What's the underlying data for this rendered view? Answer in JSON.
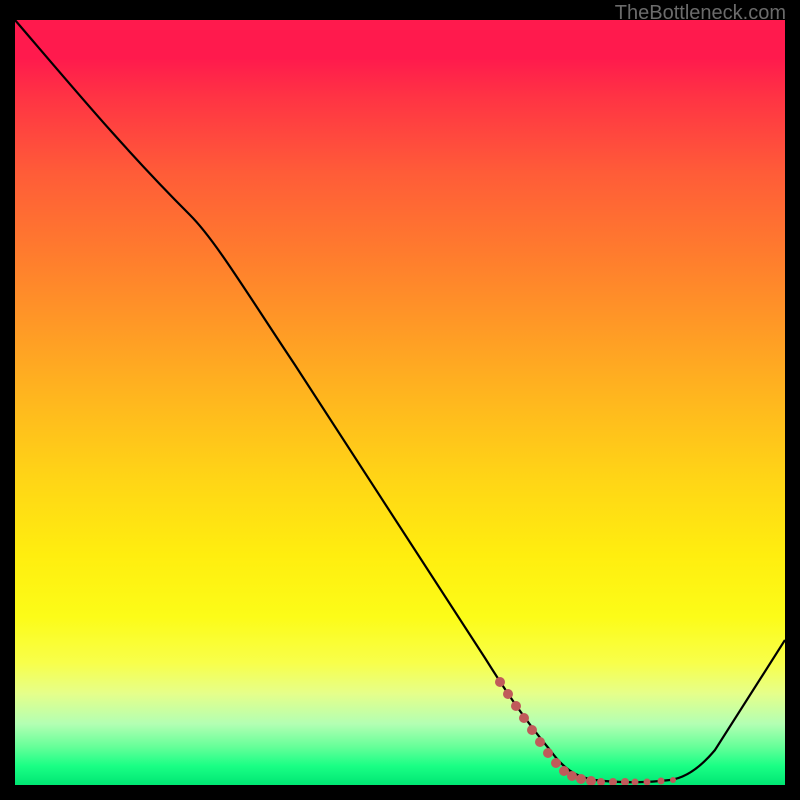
{
  "watermark": "TheBottleneck.com",
  "chart_data": {
    "type": "line",
    "title": "",
    "xlabel": "",
    "ylabel": "",
    "ylim": [
      0,
      100
    ],
    "xlim": [
      0,
      100
    ],
    "series": [
      {
        "name": "curve",
        "x": [
          0,
          10,
          20,
          30,
          40,
          50,
          60,
          65,
          70,
          75,
          80,
          85,
          90,
          100
        ],
        "y": [
          100,
          88,
          75,
          58,
          44,
          30,
          16,
          8,
          3,
          0.5,
          0,
          0,
          6,
          22
        ]
      }
    ],
    "highlight_segment": {
      "color": "#c05a5a",
      "x": [
        62,
        65,
        68,
        70,
        72,
        74,
        76,
        78,
        80,
        82,
        84,
        86
      ],
      "y": [
        11,
        8,
        5,
        3,
        2,
        1.2,
        0.8,
        0.5,
        0.3,
        0.2,
        0.1,
        0
      ]
    },
    "gradient_stops": [
      {
        "pos": 0,
        "color": "#ff1a4d"
      },
      {
        "pos": 50,
        "color": "#ffb81e"
      },
      {
        "pos": 78,
        "color": "#fcfc18"
      },
      {
        "pos": 100,
        "color": "#00e673"
      }
    ]
  }
}
